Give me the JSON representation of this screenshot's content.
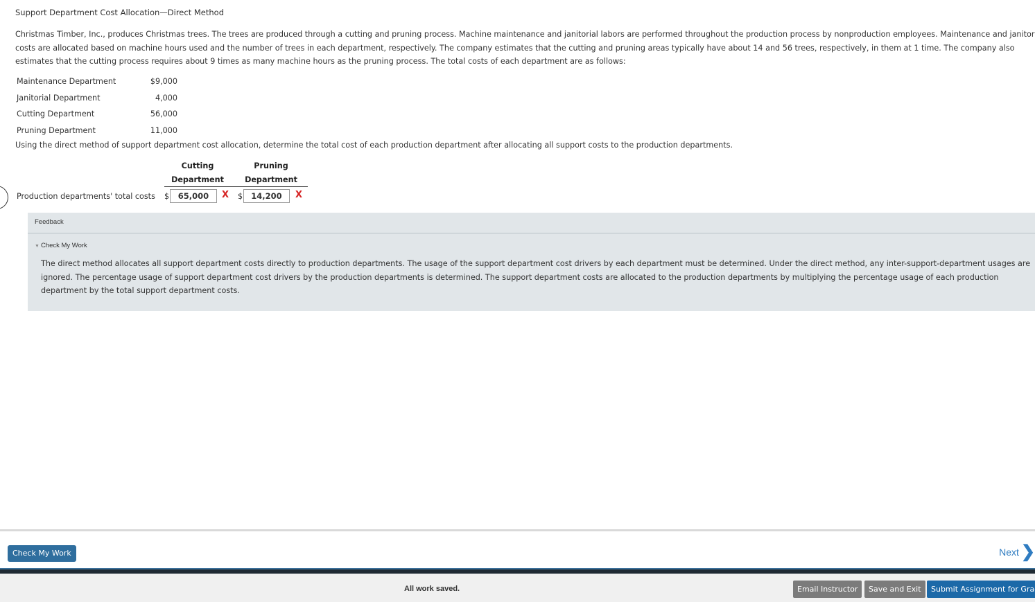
{
  "problem": {
    "title": "Support Department Cost Allocation—Direct Method",
    "intro": "Christmas Timber, Inc., produces Christmas trees. The trees are produced through a cutting and pruning process. Machine maintenance and janitorial labors are performed throughout the production process by nonproduction employees. Maintenance and janitorial costs are allocated based on machine hours used and the number of trees in each department, respectively. The company estimates that the cutting and pruning areas typically have about 14 and 56 trees, respectively, in them at 1 time. The company also estimates that the cutting process requires about 9 times as many machine hours as the pruning process. The total costs of each department are as follows:",
    "costs": [
      {
        "label": "Maintenance Department",
        "value": "$9,000"
      },
      {
        "label": "Janitorial Department",
        "value": "4,000"
      },
      {
        "label": "Cutting Department",
        "value": "56,000"
      },
      {
        "label": "Pruning Department",
        "value": "11,000"
      }
    ],
    "instruction": "Using the direct method of support department cost allocation, determine the total cost of each production department after allocating all support costs to the production departments."
  },
  "answer": {
    "col1_line1": "Cutting",
    "col1_line2": "Department",
    "col2_line1": "Pruning",
    "col2_line2": "Department",
    "row_label": "Production departments' total costs",
    "currency": "$",
    "cutting_value": "65,000",
    "pruning_value": "14,200",
    "incorrect_mark": "X"
  },
  "feedback": {
    "label": "Feedback",
    "toggle_label": "Check My Work",
    "text": "The direct method allocates all support department costs directly to production departments. The usage of the support department cost drivers by each department must be determined. Under the direct method, any inter-support-department usages are ignored. The percentage usage of support department cost drivers by the production departments is determined. The support department costs are allocated to the production departments by multiplying the percentage usage of each production department by the total support department costs."
  },
  "nav": {
    "check_label": "Check My Work",
    "next_label": "Next"
  },
  "footer": {
    "status": "All work saved.",
    "email_label": "Email Instructor",
    "save_exit_label": "Save and Exit",
    "submit_label": "Submit Assignment for Grading"
  },
  "colors": {
    "incorrect": "#d62222",
    "primary_button": "#2f6e9e",
    "link": "#2f7cc1",
    "feedback_bg": "#e1e6e9"
  },
  "icons": {
    "incorrect": "x-mark-icon",
    "next": "chevron-right-icon",
    "toggle": "triangle-down-icon"
  }
}
